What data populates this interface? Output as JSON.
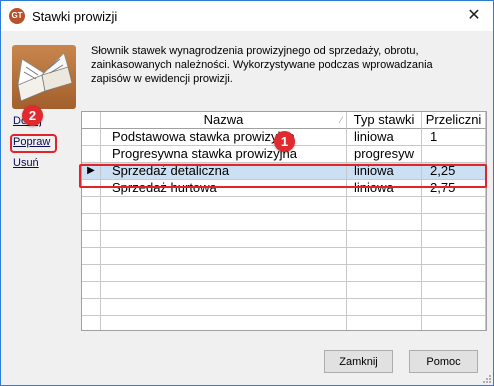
{
  "window": {
    "title": "Stawki prowizji",
    "app_icon_text": "GT"
  },
  "description": "Słownik stawek wynagrodzenia prowizyjnego od sprzedaży, obrotu, zainkasowanych należności. Wykorzystywane podczas wprowadzania zapisów w ewidencji prowizji.",
  "actions": {
    "add": "Dodaj",
    "edit": "Popraw",
    "delete": "Usuń"
  },
  "markers": {
    "grid": "1",
    "edit": "2"
  },
  "table": {
    "columns": [
      "Nazwa",
      "Typ stawki",
      "Przeliczni"
    ],
    "rows": [
      {
        "name": "Podstawowa stawka prowizyjna",
        "type": "liniowa",
        "factor": "1"
      },
      {
        "name": "Progresywna stawka prowizyjna",
        "type": "progresyw",
        "factor": ""
      },
      {
        "name": "Sprzedaż detaliczna",
        "type": "liniowa",
        "factor": "2,25"
      },
      {
        "name": "Sprzedaż hurtowa",
        "type": "liniowa",
        "factor": "2,75"
      }
    ],
    "selected_row_index": 2
  },
  "buttons": {
    "close": "Zamknij",
    "help": "Pomoc"
  },
  "colors": {
    "highlight": "#e0242b",
    "selection": "#cce0f4"
  }
}
